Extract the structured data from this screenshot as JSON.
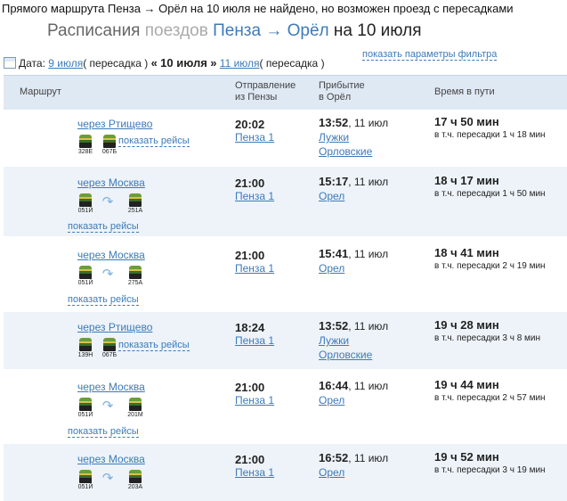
{
  "notice": "Прямого маршрута Пенза → Орёл на 10 июля не найдено, но возможен проезд с пересадками",
  "title": {
    "part1": "Расписания ",
    "part2": "поездов ",
    "part3": "Пенза → Орёл",
    "part4": " на 10 июля"
  },
  "datebar": {
    "label": "Дата:",
    "prev_date": "9 июля",
    "prev_note": "( пересадка )",
    "prev_arrow": "«",
    "current": "10 июля",
    "next_arrow": "»",
    "next_date": "11 июля",
    "next_note": "( пересадка )"
  },
  "filter_link": "показать параметры фильтра",
  "table_header": {
    "route": "Маршрут",
    "dep_line1": "Отправление",
    "dep_line2": "из Пензы",
    "arr_line1": "Прибытие",
    "arr_line2": "в Орёл",
    "duration": "Время в пути"
  },
  "show_trips": "показать рейсы",
  "transfer_prefix": "в т.ч. пересадки",
  "rows": [
    {
      "via": "через Ртищево",
      "trains": [
        "328Е",
        "067Б"
      ],
      "dep_time": "20:02",
      "dep_station": "Пенза 1",
      "arr_time": "13:52",
      "arr_date": ", 11 июл",
      "arr_station1": "Лужки",
      "arr_station2": "Орловские",
      "duration": "17 ч 50 мин",
      "transfer": "1 ч 18 мин"
    },
    {
      "via": "через Москва",
      "trains": [
        "051Й",
        "251А"
      ],
      "dep_time": "21:00",
      "dep_station": "Пенза 1",
      "arr_time": "15:17",
      "arr_date": ", 11 июл",
      "arr_station1": "Орел",
      "arr_station2": "",
      "duration": "18 ч 17 мин",
      "transfer": "1 ч 50 мин"
    },
    {
      "via": "через Москва",
      "trains": [
        "051Й",
        "275А"
      ],
      "dep_time": "21:00",
      "dep_station": "Пенза 1",
      "arr_time": "15:41",
      "arr_date": ", 11 июл",
      "arr_station1": "Орел",
      "arr_station2": "",
      "duration": "18 ч 41 мин",
      "transfer": "2 ч 19 мин"
    },
    {
      "via": "через Ртищево",
      "trains": [
        "139Н",
        "067Б"
      ],
      "dep_time": "18:24",
      "dep_station": "Пенза 1",
      "arr_time": "13:52",
      "arr_date": ", 11 июл",
      "arr_station1": "Лужки",
      "arr_station2": "Орловские",
      "duration": "19 ч 28 мин",
      "transfer": "3 ч 8 мин"
    },
    {
      "via": "через Москва",
      "trains": [
        "051Й",
        "201М"
      ],
      "dep_time": "21:00",
      "dep_station": "Пенза 1",
      "arr_time": "16:44",
      "arr_date": ", 11 июл",
      "arr_station1": "Орел",
      "arr_station2": "",
      "duration": "19 ч 44 мин",
      "transfer": "2 ч 57 мин"
    },
    {
      "via": "через Москва",
      "trains": [
        "051Й",
        "203А"
      ],
      "dep_time": "21:00",
      "dep_station": "Пенза 1",
      "arr_time": "16:52",
      "arr_date": ", 11 июл",
      "arr_station1": "Орел",
      "arr_station2": "",
      "duration": "19 ч 52 мин",
      "transfer": "3 ч 19 мин"
    }
  ]
}
